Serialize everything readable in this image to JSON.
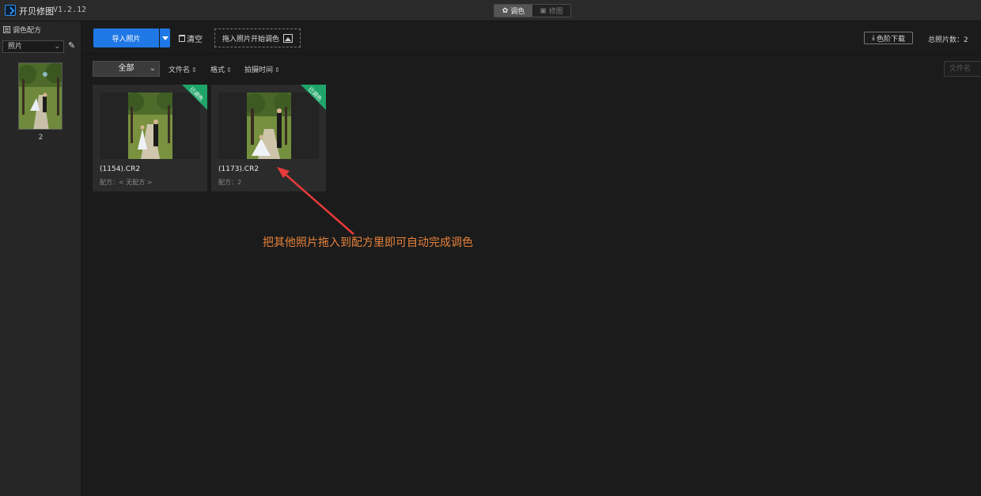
{
  "titlebar": {
    "app_name": "开贝修图",
    "version": "V1.2.12",
    "modes": [
      {
        "label": "调色",
        "icon": "aperture-icon",
        "active": true
      },
      {
        "label": "修图",
        "icon": "image-icon",
        "active": false
      }
    ]
  },
  "sidebar": {
    "header": "调色配方",
    "select_value": "照片",
    "recipe": {
      "count_label": "2"
    }
  },
  "toolbar": {
    "import_label": "导入照片",
    "clear_label": "清空",
    "drag_label": "拖入照片开始调色",
    "download_label": "色阶下载",
    "total_label": "总照片数：2"
  },
  "filterbar": {
    "filter_value": "全部",
    "sort_items": [
      "文件名",
      "格式",
      "拍摄时间"
    ],
    "search_placeholder": "文件名"
  },
  "cards": [
    {
      "name": "(1154).CR2",
      "recipe": "配方：< 无配方 >",
      "badge": "已调色"
    },
    {
      "name": "(1173).CR2",
      "recipe": "配方：2",
      "badge": "已调色"
    }
  ],
  "annotation": {
    "text": "把其他照片拖入到配方里即可自动完成调色",
    "color": "#e8823a"
  },
  "colors": {
    "accent": "#1f78e6",
    "badge": "#1fa569",
    "arrow": "#e83a3a"
  }
}
